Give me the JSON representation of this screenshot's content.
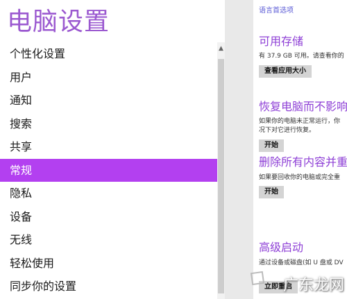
{
  "app": {
    "title": "电脑设置"
  },
  "nav": {
    "items": [
      {
        "label": "个性化设置"
      },
      {
        "label": "用户"
      },
      {
        "label": "通知"
      },
      {
        "label": "搜索"
      },
      {
        "label": "共享"
      },
      {
        "label": "常规",
        "active": true
      },
      {
        "label": "隐私"
      },
      {
        "label": "设备"
      },
      {
        "label": "无线"
      },
      {
        "label": "轻松使用"
      },
      {
        "label": "同步你的设置"
      }
    ]
  },
  "right": {
    "language_link": "语言首选项",
    "storage": {
      "title": "可用存储",
      "text": "有 37.9 GB 可用。请查看你的",
      "button": "查看应用大小"
    },
    "refresh": {
      "title": "恢复电脑而不影响",
      "text1": "如果你的电脑未正常运行，你",
      "text2": "况下对它进行恢复。",
      "button": "开始"
    },
    "reset": {
      "title": "删除所有内容并重",
      "text": "如果要回收你的电脑或完全重",
      "button": "开始"
    },
    "advanced": {
      "title": "高级启动",
      "text": "通过设备或磁盘(如 U 盘或 DV",
      "button": "立即重启"
    }
  },
  "watermark": {
    "text": "广东龙网"
  },
  "colors": {
    "accent": "#b340f0",
    "title": "#9b59d0"
  }
}
